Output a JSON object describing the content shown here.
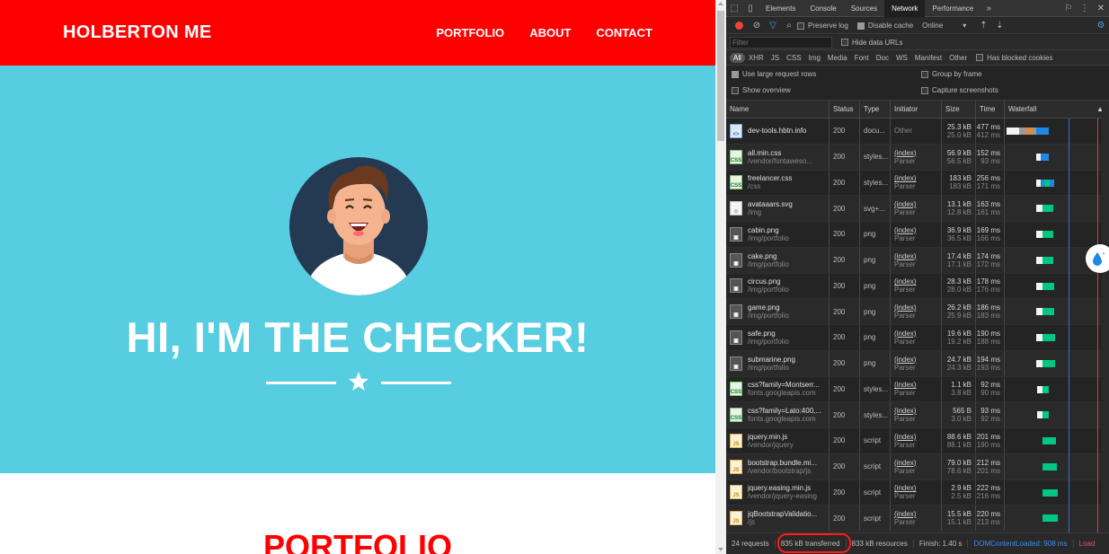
{
  "site": {
    "brand": "HOLBERTON ME",
    "nav": [
      "PORTFOLIO",
      "ABOUT",
      "CONTACT"
    ],
    "headline": "HI, I'M THE CHECKER!",
    "section_title": "PORTFOLIO",
    "colors": {
      "navbar": "#ff0000",
      "masthead": "#56cde0",
      "accent": "#ff0000"
    }
  },
  "devtools": {
    "tabs": [
      "Elements",
      "Console",
      "Sources",
      "Network",
      "Performance"
    ],
    "active_tab": "Network",
    "toolbar": {
      "preserve_log": "Preserve log",
      "disable_cache": "Disable cache",
      "throttle": "Online"
    },
    "filter": {
      "placeholder": "Filter",
      "hide_data_urls": "Hide data URLs"
    },
    "types": [
      "All",
      "XHR",
      "JS",
      "CSS",
      "Img",
      "Media",
      "Font",
      "Doc",
      "WS",
      "Manifest",
      "Other"
    ],
    "has_blocked_cookies": "Has blocked cookies",
    "options": {
      "large_rows": "Use large request rows",
      "group_by_frame": "Group by frame",
      "show_overview": "Show overview",
      "capture_screenshots": "Capture screenshots"
    },
    "columns": [
      "Name",
      "Status",
      "Type",
      "Initiator",
      "Size",
      "Time",
      "Waterfall"
    ],
    "requests": [
      {
        "name": "dev-tools.hbtn.info",
        "path": "",
        "status": "200",
        "type": "docu...",
        "initiator": "Other",
        "initiator_sub": "",
        "size": "25.3 kB",
        "size_sub": "25.0 kB",
        "time": "477 ms",
        "time_sub": "412 ms",
        "icon": "doc"
      },
      {
        "name": "all.min.css",
        "path": "/vendor/fontaweso...",
        "status": "200",
        "type": "styles...",
        "initiator": "(index)",
        "initiator_sub": "Parser",
        "size": "56.9 kB",
        "size_sub": "56.5 kB",
        "time": "152 ms",
        "time_sub": "93 ms",
        "icon": "css"
      },
      {
        "name": "freelancer.css",
        "path": "/css",
        "status": "200",
        "type": "styles...",
        "initiator": "(index)",
        "initiator_sub": "Parser",
        "size": "183 kB",
        "size_sub": "183 kB",
        "time": "256 ms",
        "time_sub": "171 ms",
        "icon": "css"
      },
      {
        "name": "avataaars.svg",
        "path": "/img",
        "status": "200",
        "type": "svg+...",
        "initiator": "(index)",
        "initiator_sub": "Parser",
        "size": "13.1 kB",
        "size_sub": "12.8 kB",
        "time": "163 ms",
        "time_sub": "161 ms",
        "icon": "svg"
      },
      {
        "name": "cabin.png",
        "path": "/img/portfolio",
        "status": "200",
        "type": "png",
        "initiator": "(index)",
        "initiator_sub": "Parser",
        "size": "36.9 kB",
        "size_sub": "36.5 kB",
        "time": "169 ms",
        "time_sub": "166 ms",
        "icon": "img"
      },
      {
        "name": "cake.png",
        "path": "/img/portfolio",
        "status": "200",
        "type": "png",
        "initiator": "(index)",
        "initiator_sub": "Parser",
        "size": "17.4 kB",
        "size_sub": "17.1 kB",
        "time": "174 ms",
        "time_sub": "172 ms",
        "icon": "img"
      },
      {
        "name": "circus.png",
        "path": "/img/portfolio",
        "status": "200",
        "type": "png",
        "initiator": "(index)",
        "initiator_sub": "Parser",
        "size": "28.3 kB",
        "size_sub": "28.0 kB",
        "time": "178 ms",
        "time_sub": "176 ms",
        "icon": "img"
      },
      {
        "name": "game.png",
        "path": "/img/portfolio",
        "status": "200",
        "type": "png",
        "initiator": "(index)",
        "initiator_sub": "Parser",
        "size": "26.2 kB",
        "size_sub": "25.9 kB",
        "time": "186 ms",
        "time_sub": "183 ms",
        "icon": "img"
      },
      {
        "name": "safe.png",
        "path": "/img/portfolio",
        "status": "200",
        "type": "png",
        "initiator": "(index)",
        "initiator_sub": "Parser",
        "size": "19.6 kB",
        "size_sub": "19.2 kB",
        "time": "190 ms",
        "time_sub": "188 ms",
        "icon": "img"
      },
      {
        "name": "submarine.png",
        "path": "/img/portfolio",
        "status": "200",
        "type": "png",
        "initiator": "(index)",
        "initiator_sub": "Parser",
        "size": "24.7 kB",
        "size_sub": "24.3 kB",
        "time": "194 ms",
        "time_sub": "193 ms",
        "icon": "img"
      },
      {
        "name": "css?family=Montserr...",
        "path": "fonts.googleapis.com",
        "status": "200",
        "type": "styles...",
        "initiator": "(index)",
        "initiator_sub": "Parser",
        "size": "1.1 kB",
        "size_sub": "3.8 kB",
        "time": "92 ms",
        "time_sub": "90 ms",
        "icon": "css"
      },
      {
        "name": "css?family=Lato:400,...",
        "path": "fonts.googleapis.com",
        "status": "200",
        "type": "styles...",
        "initiator": "(index)",
        "initiator_sub": "Parser",
        "size": "565 B",
        "size_sub": "3.0 kB",
        "time": "93 ms",
        "time_sub": "92 ms",
        "icon": "css"
      },
      {
        "name": "jquery.min.js",
        "path": "/vendor/jquery",
        "status": "200",
        "type": "script",
        "initiator": "(index)",
        "initiator_sub": "Parser",
        "size": "88.6 kB",
        "size_sub": "88.1 kB",
        "time": "201 ms",
        "time_sub": "190 ms",
        "icon": "js"
      },
      {
        "name": "bootstrap.bundle.mi...",
        "path": "/vendor/bootstrap/js",
        "status": "200",
        "type": "script",
        "initiator": "(index)",
        "initiator_sub": "Parser",
        "size": "79.0 kB",
        "size_sub": "78.6 kB",
        "time": "212 ms",
        "time_sub": "201 ms",
        "icon": "js"
      },
      {
        "name": "jquery.easing.min.js",
        "path": "/vendor/jquery-easing",
        "status": "200",
        "type": "script",
        "initiator": "(index)",
        "initiator_sub": "Parser",
        "size": "2.9 kB",
        "size_sub": "2.5 kB",
        "time": "222 ms",
        "time_sub": "216 ms",
        "icon": "js"
      },
      {
        "name": "jqBootstrapValidatio...",
        "path": "/js",
        "status": "200",
        "type": "script",
        "initiator": "(index)",
        "initiator_sub": "Parser",
        "size": "15.5 kB",
        "size_sub": "15.1 kB",
        "time": "220 ms",
        "time_sub": "213 ms",
        "icon": "js"
      }
    ],
    "status": {
      "requests": "24 requests",
      "transferred": "835 kB transferred",
      "resources": "833 kB resources",
      "finish": "Finish: 1.40 s",
      "dom_loaded": "DOMContentLoaded: 908 ms",
      "load": "Load"
    }
  }
}
